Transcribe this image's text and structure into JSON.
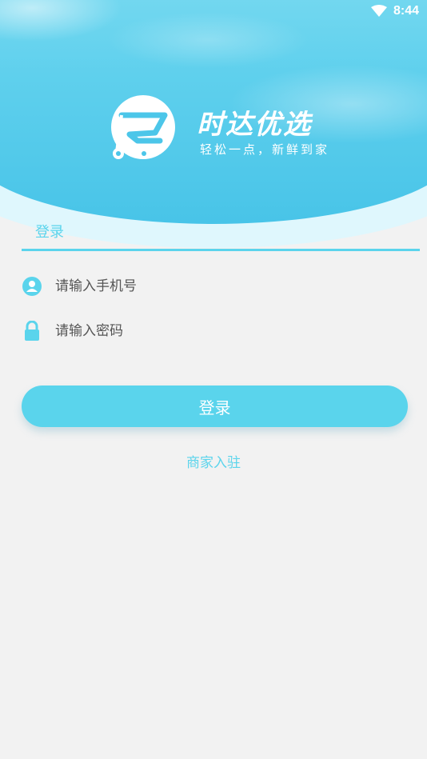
{
  "status_bar": {
    "time": "8:44",
    "wifi_icon": "wifi-icon"
  },
  "brand": {
    "name": "时达优选",
    "slogan": "轻松一点，新鲜到家",
    "logo_icon": "shopping-cart-logo-icon"
  },
  "tabs": {
    "login_label": "登录"
  },
  "form": {
    "phone_placeholder": "请输入手机号",
    "phone_value": "",
    "phone_icon": "user-icon",
    "password_placeholder": "请输入密码",
    "password_value": "",
    "password_icon": "lock-icon"
  },
  "actions": {
    "login_button_label": "登录",
    "merchant_link_label": "商家入驻"
  },
  "colors": {
    "accent": "#5ad4ec",
    "background": "#f2f2f2",
    "hero_top": "#7edcf1",
    "hero_bottom": "#48c4e8"
  }
}
